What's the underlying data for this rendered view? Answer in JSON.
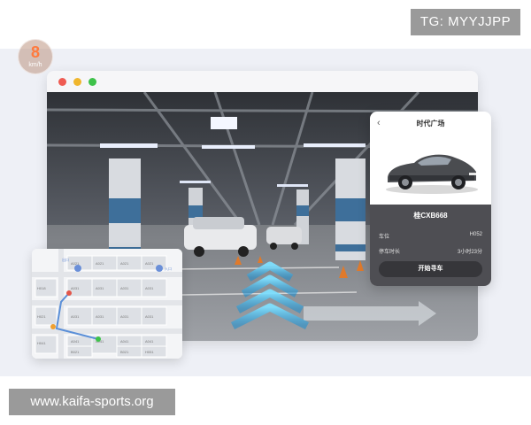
{
  "badge": {
    "text": "TG: MYYJJPP"
  },
  "watermark": {
    "text": "www.kaifa-sports.org"
  },
  "speedometer": {
    "value": "8",
    "unit": "km/h"
  },
  "panel": {
    "title": "时代广场",
    "plate": "桂CXB668",
    "rows": [
      {
        "label": "车位",
        "value": "H052"
      },
      {
        "label": "停车时长",
        "value": "3小时23分"
      }
    ],
    "button": "开始寻车"
  },
  "map": {
    "entrances": [
      {
        "label": "出口"
      },
      {
        "label": "入口"
      }
    ],
    "slots": [
      "A021",
      "A021",
      "A021",
      "A021",
      "H018",
      "A031",
      "A031",
      "A031",
      "H021",
      "A031",
      "A031",
      "A031",
      "A031",
      "H041",
      "A041",
      "A041",
      "A041",
      "A041",
      "B021",
      "A031",
      "B021",
      "H051"
    ]
  },
  "colors": {
    "speed_accent": "#ff7a3d",
    "arrow": "#4cc8f0",
    "route": "#5a8fd8"
  }
}
